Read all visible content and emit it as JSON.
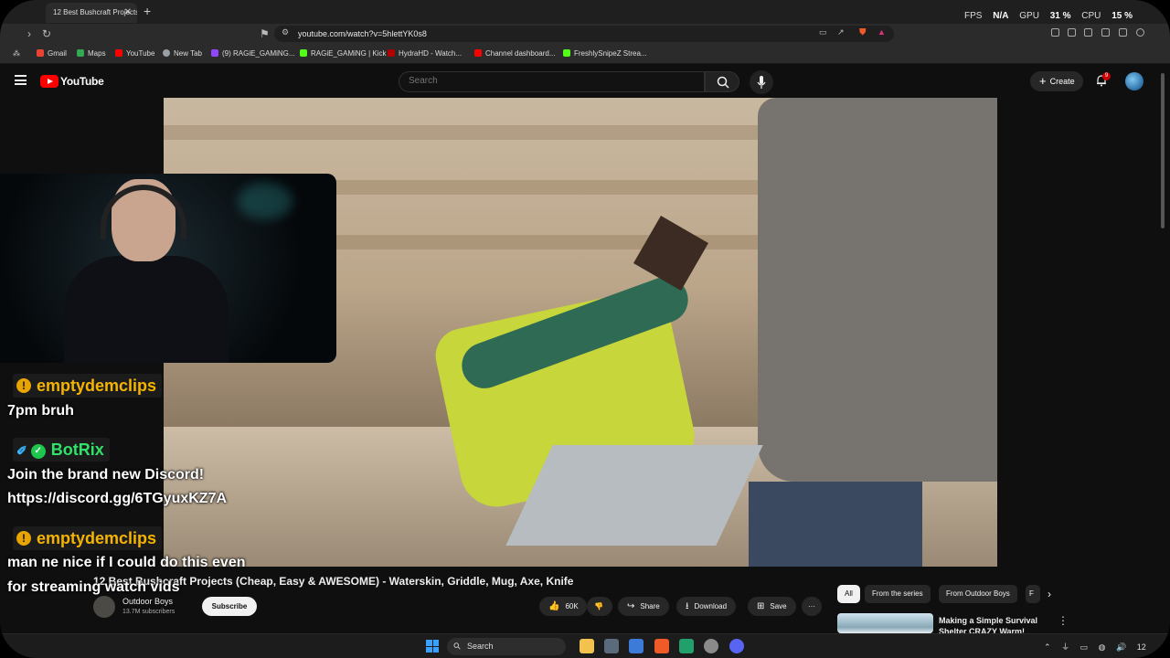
{
  "browser": {
    "tab_title": "12 Best Bushcraft Projects",
    "url": "youtube.com/watch?v=5hlettYK0s8",
    "perf": {
      "fps_label": "FPS",
      "fps_value": "N/A",
      "gpu_label": "GPU",
      "gpu_value": "31 %",
      "cpu_label": "CPU",
      "cpu_value": "15 %"
    },
    "bookmarks": [
      {
        "label": "Gmail",
        "color": "#ea4335"
      },
      {
        "label": "Maps",
        "color": "#34a853"
      },
      {
        "label": "YouTube",
        "color": "#ff0000"
      },
      {
        "label": "New Tab",
        "color": "#9aa0a6"
      },
      {
        "label": "(9) RAGiE_GAMiNG...",
        "color": "#9146ff"
      },
      {
        "label": "RAGiE_GAMiNG | Kick",
        "color": "#53fc18"
      },
      {
        "label": "HydraHD - Watch...",
        "color": "#b10000"
      },
      {
        "label": "Channel dashboard...",
        "color": "#ff0000"
      },
      {
        "label": "FreshlySnipeZ Strea...",
        "color": "#53fc18"
      }
    ]
  },
  "youtube": {
    "logo_text": "YouTube",
    "search_placeholder": "Search",
    "create_label": "Create",
    "notification_count": "9"
  },
  "chat": [
    {
      "user": "emptydemclips",
      "badge": "!",
      "user_color": "#f4b400",
      "message": "7pm bruh"
    },
    {
      "user": "BotRix",
      "badge": "✓",
      "user_color": "#2fe36a",
      "message_lines": [
        "Join the brand new Discord!",
        "https://discord.gg/6TGyuxKZ7A"
      ]
    },
    {
      "user": "emptydemclips",
      "badge": "!",
      "user_color": "#f4b400",
      "message_lines": [
        "man ne nice if I could do this even",
        "for streaming watch vids"
      ]
    }
  ],
  "video": {
    "title": "12 Best Bushcraft Projects (Cheap, Easy & AWESOME) - Waterskin, Griddle, Mug, Axe, Knife",
    "channel": "Outdoor Boys",
    "subscribers": "13.7M subscribers",
    "subscribe_label": "Subscribe",
    "likes": "60K",
    "share_label": "Share",
    "download_label": "Download",
    "save_label": "Save",
    "more_label": "···"
  },
  "sidebar": {
    "chips": [
      "All",
      "From the series",
      "From Outdoor Boys",
      "F"
    ],
    "recommendation": {
      "title": "Making a Simple Survival Shelter CRAZY Warm! Winter"
    }
  },
  "taskbar": {
    "search_label": "Search",
    "time": "12"
  }
}
